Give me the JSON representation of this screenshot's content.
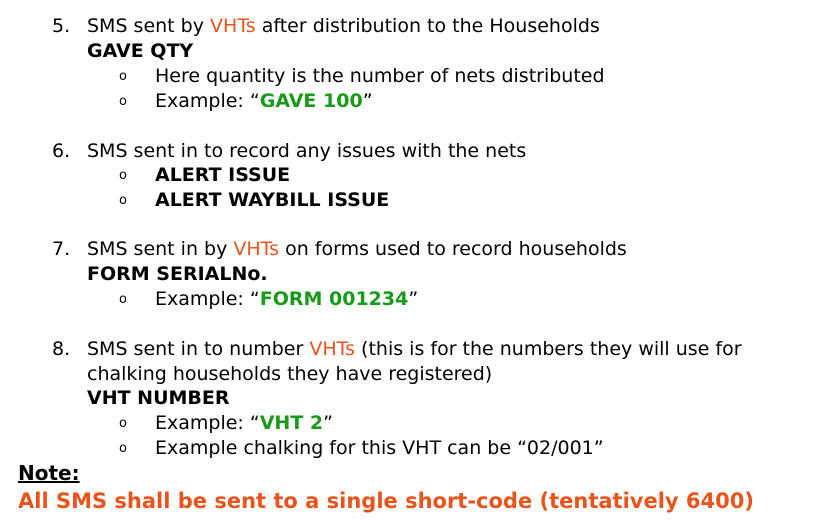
{
  "items": [
    {
      "number": "5.",
      "text_pre": "SMS sent by ",
      "highlight": "VHTs",
      "text_post": " after distribution to the Households",
      "command": "GAVE QTY",
      "bullets": [
        {
          "text": "Here quantity is the number of nets distributed"
        },
        {
          "pre": "Example: “",
          "code": "GAVE 100",
          "post": "”"
        }
      ]
    },
    {
      "number": "6.",
      "text": "SMS sent in to record any issues with the nets",
      "bullets": [
        {
          "text": "ALERT ISSUE"
        },
        {
          "text": "ALERT WAYBILL ISSUE"
        }
      ]
    },
    {
      "number": "7.",
      "text_pre": "SMS sent in by ",
      "highlight": "VHTs",
      "text_post": " on forms used to record households",
      "command": "FORM SERIALNo.",
      "bullets": [
        {
          "pre": "Example: “",
          "code": "FORM 001234",
          "post": "”"
        }
      ]
    },
    {
      "number": "8.",
      "text_pre": "SMS sent in to number ",
      "highlight": "VHTs",
      "text_post": " (this is for the numbers they will use for",
      "text_line2": "chalking households they have registered)",
      "command": "VHT NUMBER",
      "bullets": [
        {
          "pre": "Example: “",
          "code": "VHT 2",
          "post": "”"
        },
        {
          "text": "Example chalking for this VHT can be “02/001”"
        }
      ]
    }
  ],
  "bullet_glyph": "o",
  "note_label": "Note:",
  "footer_text": "All SMS shall be sent to a single short-code (tentatively 6400)",
  "colors": {
    "highlight": "#e8541c",
    "code": "#1a9a1a"
  }
}
